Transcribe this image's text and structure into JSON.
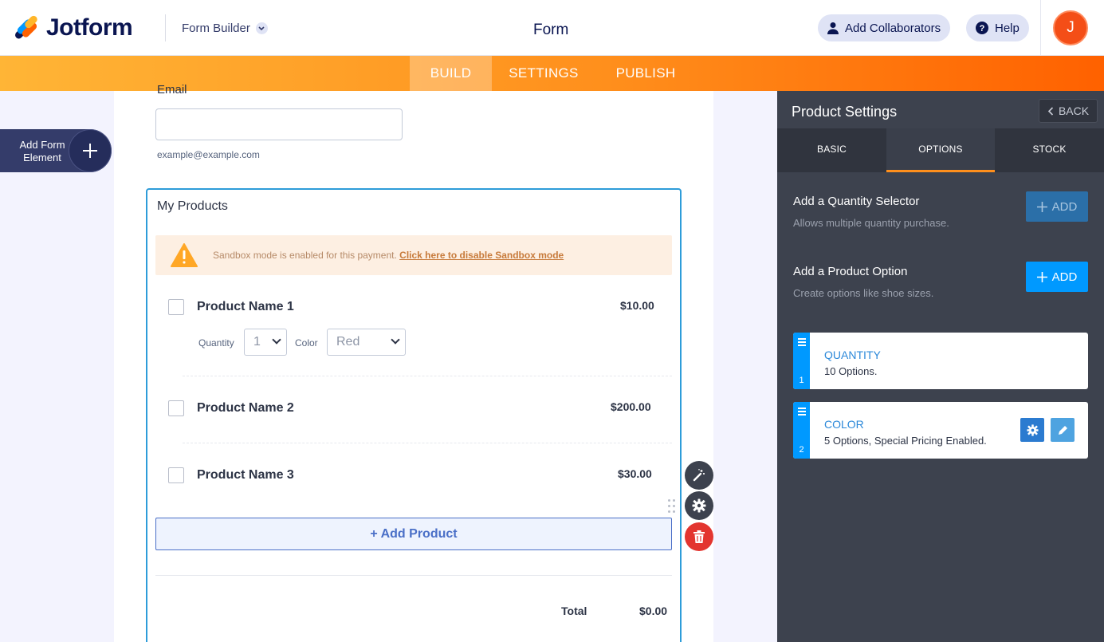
{
  "header": {
    "brand": "Jotform",
    "builder_label": "Form Builder",
    "form_title": "Form",
    "collaborators_label": "Add Collaborators",
    "help_label": "Help",
    "avatar_initial": "J"
  },
  "nav": {
    "tabs": [
      {
        "label": "BUILD",
        "active": true
      },
      {
        "label": "SETTINGS",
        "active": false
      },
      {
        "label": "PUBLISH",
        "active": false
      }
    ]
  },
  "sidebar": {
    "add_element_label": "Add Form Element"
  },
  "form": {
    "email_label": "Email",
    "email_value": "",
    "email_sublabel": "example@example.com",
    "products_title": "My Products",
    "sandbox_text": "Sandbox mode is enabled for this payment.",
    "sandbox_link": "Click here to disable Sandbox mode",
    "products": [
      {
        "name": "Product Name 1",
        "price": "$10.00",
        "quantity_label": "Quantity",
        "quantity_value": "1",
        "color_label": "Color",
        "color_value": "Red"
      },
      {
        "name": "Product Name 2",
        "price": "$200.00"
      },
      {
        "name": "Product Name 3",
        "price": "$30.00"
      }
    ],
    "add_product_label": "+ Add Product",
    "total_label": "Total",
    "total_value": "$0.00"
  },
  "panel": {
    "title": "Product Settings",
    "back_label": "BACK",
    "tabs": [
      {
        "label": "BASIC",
        "active": false
      },
      {
        "label": "OPTIONS",
        "active": true
      },
      {
        "label": "STOCK",
        "active": false
      }
    ],
    "quantity_selector": {
      "title": "Add a Quantity Selector",
      "desc": "Allows multiple quantity purchase.",
      "button": "ADD"
    },
    "product_option": {
      "title": "Add a Product Option",
      "desc": "Create options like shoe sizes.",
      "button": "ADD"
    },
    "options": [
      {
        "index": "1",
        "name": "QUANTITY",
        "summary": "10 Options."
      },
      {
        "index": "2",
        "name": "COLOR",
        "summary": "5 Options, Special Pricing Enabled."
      }
    ]
  },
  "colors": {
    "accent_orange": "#ff8f1c",
    "accent_blue": "#0099ff",
    "panel_bg": "#3d424e",
    "delete_red": "#e3352f"
  }
}
